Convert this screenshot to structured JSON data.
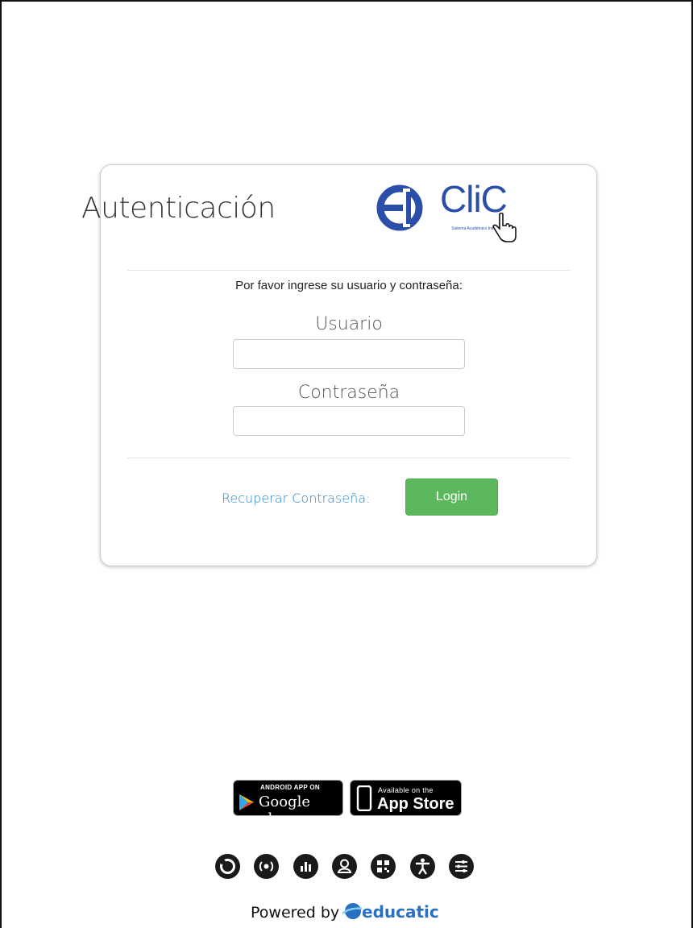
{
  "login": {
    "title": "Autenticación",
    "logo_word": "CliC",
    "logo_subtitle": "Sistema Académico Institucional",
    "prompt": "Por favor ingrese su usuario y contraseña:",
    "username_label": "Usuario",
    "username_value": "",
    "password_label": "Contraseña",
    "password_value": "",
    "recover_link": "Recuperar Contraseña:",
    "login_button": "Login"
  },
  "stores": {
    "google_small": "ANDROID APP ON",
    "google_big": "Google play",
    "apple_small": "Available on the",
    "apple_big": "App Store"
  },
  "footer": {
    "icons": [
      "refresh-icon",
      "radio-icon",
      "chart-icon",
      "user-icon",
      "qr-code-icon",
      "accessibility-icon",
      "settings-icon"
    ],
    "powered_by": "Powered by",
    "brand": "educatic"
  },
  "colors": {
    "brand_blue": "#2b4fa8",
    "link_blue": "#2a84c6",
    "button_green": "#5cb85c",
    "educatic_blue": "#2a6fc0"
  }
}
